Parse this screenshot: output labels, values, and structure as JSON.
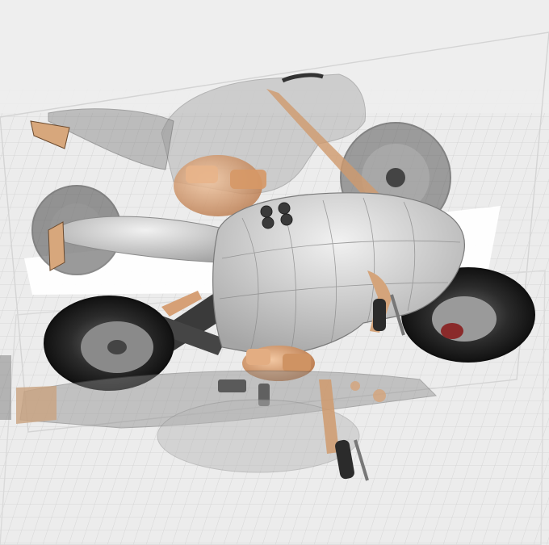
{
  "scene": {
    "subject": "motorcycle-cad-model",
    "views": [
      "side-view-transparent",
      "top-view-shaded",
      "bottom-view-transparent"
    ],
    "colors": {
      "background": "#ececec",
      "grid_line": "#c9c9c9",
      "body_shell": "#d9d9d9",
      "wireframe": "#7d7d7d",
      "tire": "#1c1c1c",
      "engine_copper": "#d9a277",
      "frame_dark": "#3a3a3a",
      "accent_red": "#8a2a2a"
    }
  }
}
